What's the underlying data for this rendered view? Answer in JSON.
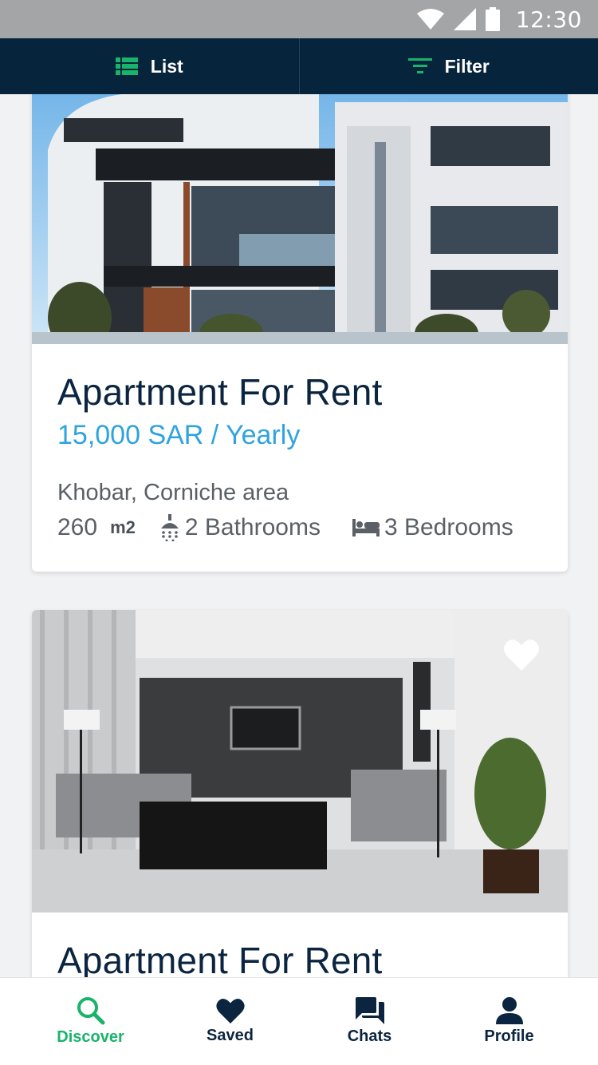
{
  "status_bar": {
    "time": "12:30"
  },
  "topbar": {
    "list_label": "List",
    "filter_label": "Filter"
  },
  "listings": [
    {
      "title": "Apartment For Rent",
      "price": "15,000 SAR / Yearly",
      "location": "Khobar, Corniche area",
      "area": "260",
      "area_unit": "m2",
      "bathrooms": "2 Bathrooms",
      "bedrooms": "3 Bedrooms"
    },
    {
      "title": "Apartment For Rent"
    }
  ],
  "bottom_nav": {
    "discover": "Discover",
    "saved": "Saved",
    "chats": "Chats",
    "profile": "Profile"
  },
  "colors": {
    "primary_dark": "#06243b",
    "accent_green": "#19b36b",
    "price_blue": "#2fa3de"
  }
}
